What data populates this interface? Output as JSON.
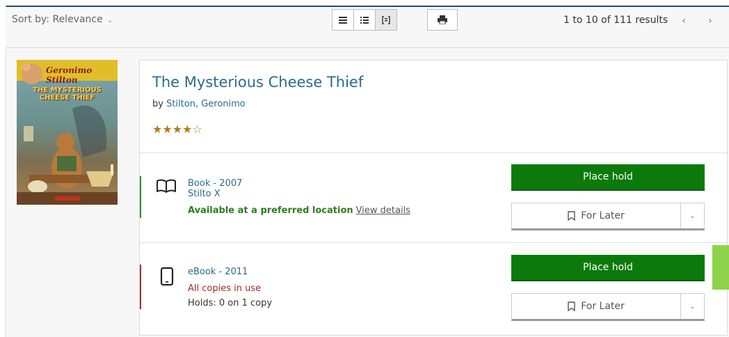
{
  "toolbar": {
    "sort_label": "Sort by: Relevance",
    "results": "1 to 10 of 111 results",
    "prev": "‹",
    "next": "›"
  },
  "cover": {
    "brand": "Geronimo Stilton",
    "title_line1": "THE MYSTERIOUS",
    "title_line2": "CHEESE THIEF"
  },
  "item": {
    "title": "The Mysterious Cheese Thief",
    "by_prefix": "by ",
    "author": "Stilton, Geronimo",
    "stars": "★★★★☆",
    "rating": 4
  },
  "formats": [
    {
      "name": "Book - 2007",
      "call_number": "Stilto X",
      "availability": "Available at a preferred location",
      "details_link": "View details",
      "status_color": "#2e8b2e"
    },
    {
      "name": "eBook - 2011",
      "availability": "All copies in use",
      "holds": "Holds: 0 on 1 copy",
      "status_color": "#a83228"
    }
  ],
  "actions": {
    "place_hold": "Place hold",
    "for_later": "For Later"
  },
  "colors": {
    "accent_green": "#0b7a0b",
    "link_blue": "#2a6c8b",
    "nav_dark": "#2a4d63"
  }
}
